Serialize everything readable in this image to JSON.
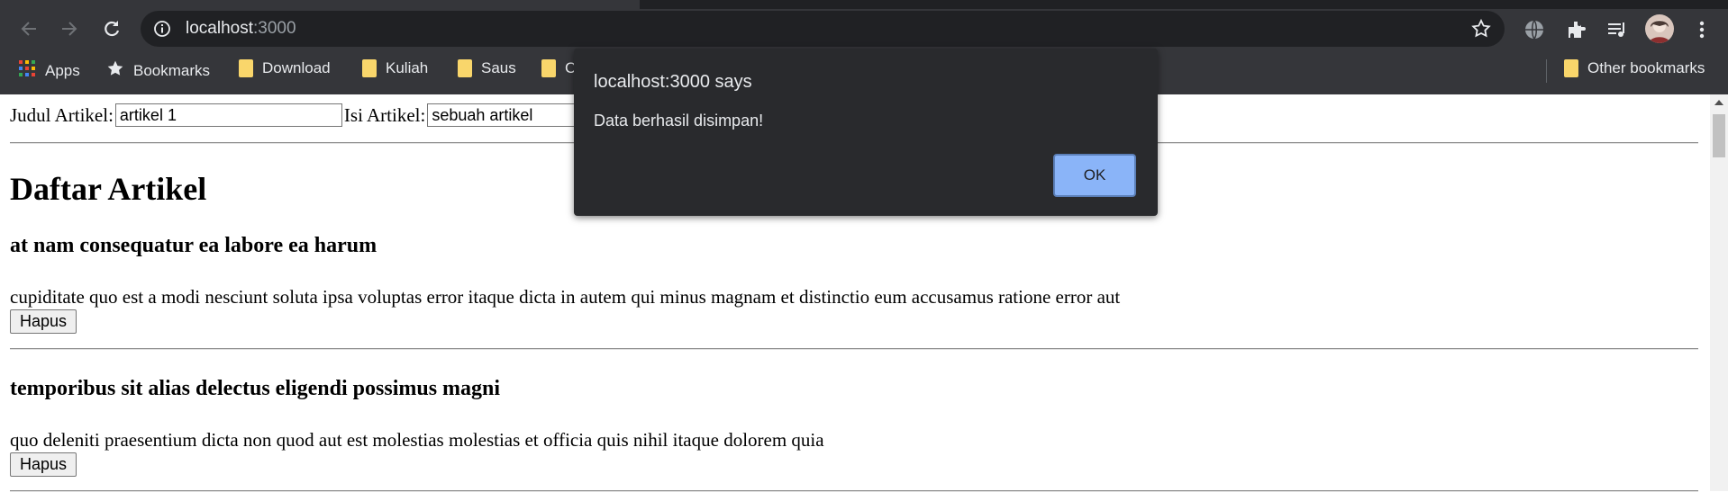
{
  "browser": {
    "url_host": "localhost",
    "url_port": ":3000",
    "bookmarks": [
      {
        "label": "Apps",
        "icon": "apps-grid-icon"
      },
      {
        "label": "Bookmarks",
        "icon": "star-icon"
      },
      {
        "label": "Download",
        "icon": "folder-icon"
      },
      {
        "label": "Kuliah",
        "icon": "folder-icon"
      },
      {
        "label": "Saus",
        "icon": "folder-icon"
      },
      {
        "label": "C",
        "icon": "folder-icon"
      }
    ],
    "other_bookmarks": "Other bookmarks"
  },
  "form": {
    "judul_label": "Judul Artikel:",
    "judul_value": "artikel 1",
    "isi_label": "Isi Artikel:",
    "isi_value": "sebuah artikel"
  },
  "main": {
    "heading": "Daftar Artikel",
    "articles": [
      {
        "title": "at nam consequatur ea labore ea harum",
        "body": "cupiditate quo est a modi nesciunt soluta ipsa voluptas error itaque dicta in autem qui minus magnam et distinctio eum accusamus ratione error aut",
        "delete_label": "Hapus"
      },
      {
        "title": "temporibus sit alias delectus eligendi possimus magni",
        "body": "quo deleniti praesentium dicta non quod aut est molestias molestias et officia quis nihil itaque dolorem quia",
        "delete_label": "Hapus"
      }
    ]
  },
  "dialog": {
    "title": "localhost:3000 says",
    "message": "Data berhasil disimpan!",
    "ok_label": "OK"
  },
  "colors": {
    "chrome_bg": "#35363a",
    "dialog_bg": "#292a2d",
    "ok_button": "#8ab4f8",
    "folder": "#f9d66b"
  }
}
